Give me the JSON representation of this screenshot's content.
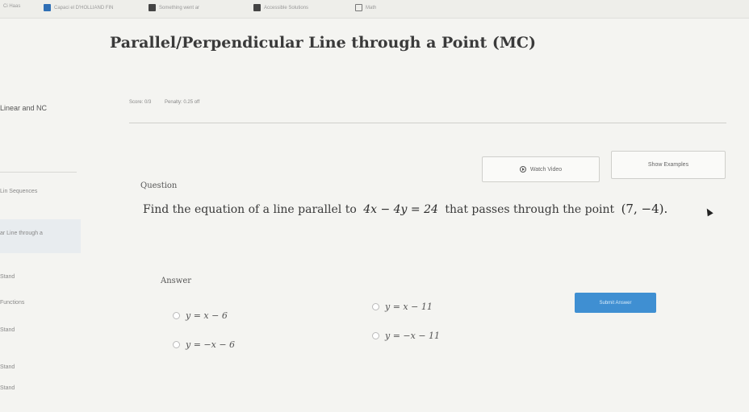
{
  "bookmarks": [
    {
      "label": "Ci Haas",
      "icon": ""
    },
    {
      "label": "Capaci el D'HOLLIAND FIN",
      "icon": "bookmark-icon"
    },
    {
      "label": "Something went ar",
      "icon": "folder-icon"
    },
    {
      "label": "Accessible Solutions",
      "icon": "bookmark-icon"
    },
    {
      "label": "",
      "icon": "folder-icon"
    },
    {
      "label": "Math",
      "icon": ""
    }
  ],
  "page": {
    "title": "Parallel/Perpendicular Line through a Point (MC)"
  },
  "sidebar": {
    "course": "Linear and NC",
    "items": [
      "Lin Sequences",
      "ar Line through a",
      "Stand",
      "Functions",
      "Stand",
      "Stand",
      "Stand"
    ]
  },
  "score": {
    "score_label": "Score: 0/3",
    "penalty_label": "Penalty: 0.25 off"
  },
  "buttons": {
    "watch_video": "Watch Video",
    "show_examples": "Show Examples",
    "submit": "Submit Answer"
  },
  "question": {
    "label": "Question",
    "prompt_prefix": "Find the equation of a line parallel to",
    "equation": "4x − 4y = 24",
    "prompt_middle": "that passes through the point",
    "point": "(7, −4)."
  },
  "answer": {
    "label": "Answer",
    "choices": [
      "y = x − 6",
      "y = x − 11",
      "y = −x − 6",
      "y = −x − 11"
    ]
  },
  "colors": {
    "accent": "#3f8fd2",
    "background": "#f4f4f1"
  }
}
